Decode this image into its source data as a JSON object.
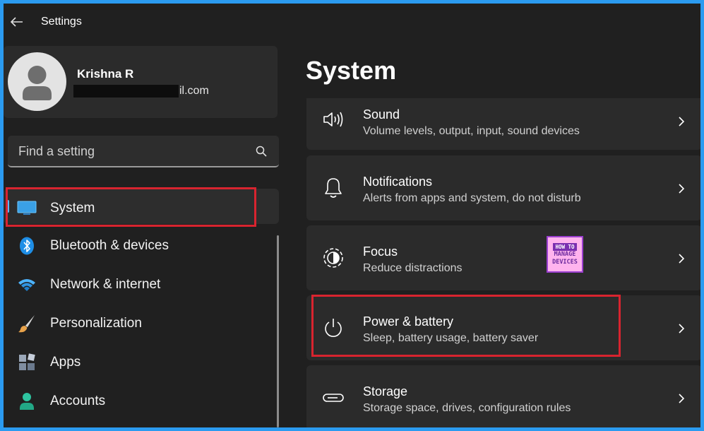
{
  "window": {
    "title": "Settings",
    "accent": "#60b6ff"
  },
  "profile": {
    "name": "Krishna R",
    "email_suffix": "il.com"
  },
  "search": {
    "placeholder": "Find a setting"
  },
  "nav": {
    "items": [
      {
        "label": "System",
        "icon": "monitor-icon",
        "active": true
      },
      {
        "label": "Bluetooth & devices",
        "icon": "bluetooth-icon"
      },
      {
        "label": "Network & internet",
        "icon": "wifi-icon"
      },
      {
        "label": "Personalization",
        "icon": "brush-icon"
      },
      {
        "label": "Apps",
        "icon": "apps-icon"
      },
      {
        "label": "Accounts",
        "icon": "person-icon"
      }
    ]
  },
  "main": {
    "title": "System",
    "cards": [
      {
        "title": "Sound",
        "subtitle": "Volume levels, output, input, sound devices",
        "icon": "speaker-icon"
      },
      {
        "title": "Notifications",
        "subtitle": "Alerts from apps and system, do not disturb",
        "icon": "bell-icon"
      },
      {
        "title": "Focus",
        "subtitle": "Reduce distractions",
        "icon": "focus-icon"
      },
      {
        "title": "Power & battery",
        "subtitle": "Sleep, battery usage, battery saver",
        "icon": "power-icon"
      },
      {
        "title": "Storage",
        "subtitle": "Storage space, drives, configuration rules",
        "icon": "storage-icon"
      }
    ]
  },
  "watermark": {
    "line1": "HOW TO",
    "line2": "MANAGE",
    "line3": "DEVICES"
  },
  "highlight_color": "#d8242f"
}
